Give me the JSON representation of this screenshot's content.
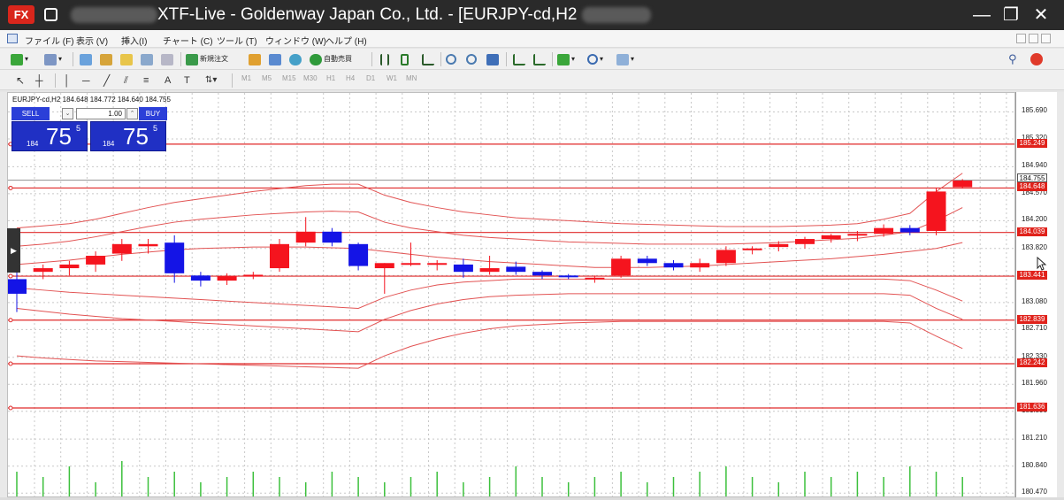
{
  "title_bar": {
    "title": "XTF-Live - Goldenway Japan Co., Ltd. - [EURJPY-cd,H2 ",
    "logo": "FX",
    "minimize_glyph": "—",
    "maximize_glyph": "❐",
    "close_glyph": "✕"
  },
  "menu": {
    "items": [
      "ファイル (F)",
      "表示 (V)",
      "挿入(I)",
      "チャート (C)",
      "ツール (T)",
      "ウィンドウ (W)",
      "ヘルプ (H)"
    ]
  },
  "toolbar": {
    "new_order_label": "新規注文",
    "auto_trading_label": "自動売買"
  },
  "timeframes": [
    "M1",
    "M5",
    "M15",
    "M30",
    "H1",
    "H4",
    "D1",
    "W1",
    "MN"
  ],
  "chart": {
    "symbol_label": "EURJPY-cd,H2  184.648 184.772 184.640 184.755",
    "price_ticks": [
      "185.690",
      "185.320",
      "184.940",
      "184.570",
      "184.200",
      "183.820",
      "183.450",
      "183.080",
      "182.710",
      "182.330",
      "181.960",
      "181.590",
      "181.210",
      "180.840",
      "180.470"
    ],
    "tags": {
      "bid": "184.755",
      "lines": [
        "185.249",
        "184.648",
        "184.039",
        "183.441",
        "182.839",
        "182.242",
        "181.636"
      ]
    },
    "colors": {
      "bull": "#f5141e",
      "bear": "#1414e6",
      "band": "#e25353",
      "level": "#e02a2a",
      "grid": "#c8c8c8"
    }
  },
  "trade_panel": {
    "sell_label": "SELL",
    "buy_label": "BUY",
    "lot": "1.00",
    "spin_down": "⌄",
    "spin_up": "⌃",
    "sell_quote": {
      "big": "184",
      "main": "75",
      "sup": "5"
    },
    "buy_quote": {
      "big": "184",
      "main": "75",
      "sup": "5"
    }
  },
  "chart_data": {
    "type": "candlestick",
    "symbol": "EURJPY-cd",
    "timeframe": "H2",
    "ylim": [
      180.4,
      185.95
    ],
    "candles": [
      {
        "o": 183.4,
        "h": 183.55,
        "l": 182.95,
        "c": 183.2
      },
      {
        "o": 183.5,
        "h": 183.6,
        "l": 183.4,
        "c": 183.55
      },
      {
        "o": 183.55,
        "h": 183.65,
        "l": 183.45,
        "c": 183.6
      },
      {
        "o": 183.6,
        "h": 183.78,
        "l": 183.5,
        "c": 183.72
      },
      {
        "o": 183.75,
        "h": 183.95,
        "l": 183.65,
        "c": 183.88
      },
      {
        "o": 183.85,
        "h": 183.95,
        "l": 183.75,
        "c": 183.88
      },
      {
        "o": 183.9,
        "h": 184.0,
        "l": 183.35,
        "c": 183.48
      },
      {
        "o": 183.45,
        "h": 183.5,
        "l": 183.3,
        "c": 183.38
      },
      {
        "o": 183.38,
        "h": 183.48,
        "l": 183.32,
        "c": 183.44
      },
      {
        "o": 183.44,
        "h": 183.5,
        "l": 183.4,
        "c": 183.46
      },
      {
        "o": 183.55,
        "h": 183.95,
        "l": 183.5,
        "c": 183.88
      },
      {
        "o": 183.9,
        "h": 184.25,
        "l": 183.85,
        "c": 184.05
      },
      {
        "o": 184.05,
        "h": 184.1,
        "l": 183.85,
        "c": 183.9
      },
      {
        "o": 183.88,
        "h": 183.9,
        "l": 183.52,
        "c": 183.58
      },
      {
        "o": 183.55,
        "h": 183.62,
        "l": 183.2,
        "c": 183.62
      },
      {
        "o": 183.62,
        "h": 183.9,
        "l": 183.58,
        "c": 183.62
      },
      {
        "o": 183.6,
        "h": 183.66,
        "l": 183.52,
        "c": 183.62
      },
      {
        "o": 183.6,
        "h": 183.68,
        "l": 183.42,
        "c": 183.5
      },
      {
        "o": 183.5,
        "h": 183.72,
        "l": 183.46,
        "c": 183.55
      },
      {
        "o": 183.57,
        "h": 183.64,
        "l": 183.46,
        "c": 183.5
      },
      {
        "o": 183.5,
        "h": 183.52,
        "l": 183.4,
        "c": 183.45
      },
      {
        "o": 183.45,
        "h": 183.47,
        "l": 183.4,
        "c": 183.44
      },
      {
        "o": 183.4,
        "h": 183.45,
        "l": 183.35,
        "c": 183.42
      },
      {
        "o": 183.45,
        "h": 183.72,
        "l": 183.42,
        "c": 183.68
      },
      {
        "o": 183.68,
        "h": 183.72,
        "l": 183.58,
        "c": 183.62
      },
      {
        "o": 183.62,
        "h": 183.66,
        "l": 183.52,
        "c": 183.56
      },
      {
        "o": 183.56,
        "h": 183.68,
        "l": 183.5,
        "c": 183.62
      },
      {
        "o": 183.62,
        "h": 183.85,
        "l": 183.58,
        "c": 183.8
      },
      {
        "o": 183.8,
        "h": 183.85,
        "l": 183.74,
        "c": 183.82
      },
      {
        "o": 183.84,
        "h": 183.92,
        "l": 183.78,
        "c": 183.88
      },
      {
        "o": 183.88,
        "h": 183.98,
        "l": 183.82,
        "c": 183.95
      },
      {
        "o": 183.95,
        "h": 184.02,
        "l": 183.9,
        "c": 184.0
      },
      {
        "o": 184.0,
        "h": 184.06,
        "l": 183.92,
        "c": 184.02
      },
      {
        "o": 184.02,
        "h": 184.15,
        "l": 183.98,
        "c": 184.1
      },
      {
        "o": 184.1,
        "h": 184.14,
        "l": 184.0,
        "c": 184.04
      },
      {
        "o": 184.06,
        "h": 184.65,
        "l": 184.0,
        "c": 184.6
      },
      {
        "o": 184.66,
        "h": 184.77,
        "l": 184.64,
        "c": 184.75
      }
    ],
    "bands": [
      {
        "name": "upper-outer",
        "values": [
          184.1,
          184.13,
          184.16,
          184.22,
          184.3,
          184.38,
          184.45,
          184.5,
          184.55,
          184.6,
          184.64,
          184.68,
          184.7,
          184.7,
          184.55,
          184.45,
          184.38,
          184.32,
          184.28,
          184.24,
          184.22,
          184.2,
          184.18,
          184.16,
          184.15,
          184.14,
          184.13,
          184.12,
          184.12,
          184.12,
          184.13,
          184.14,
          184.16,
          184.22,
          184.3,
          184.6,
          184.85
        ]
      },
      {
        "name": "upper-inner",
        "values": [
          183.85,
          183.88,
          183.92,
          183.98,
          184.05,
          184.12,
          184.18,
          184.22,
          184.25,
          184.28,
          184.3,
          184.32,
          184.33,
          184.32,
          184.18,
          184.1,
          184.05,
          184.0,
          183.97,
          183.95,
          183.93,
          183.91,
          183.9,
          183.89,
          183.88,
          183.88,
          183.88,
          183.88,
          183.89,
          183.9,
          183.92,
          183.94,
          183.96,
          184.0,
          184.05,
          184.2,
          184.38
        ]
      },
      {
        "name": "middle",
        "values": [
          183.6,
          183.63,
          183.66,
          183.7,
          183.74,
          183.77,
          183.8,
          183.82,
          183.83,
          183.84,
          183.84,
          183.84,
          183.83,
          183.82,
          183.78,
          183.74,
          183.7,
          183.67,
          183.64,
          183.62,
          183.6,
          183.58,
          183.56,
          183.56,
          183.56,
          183.57,
          183.58,
          183.6,
          183.62,
          183.64,
          183.66,
          183.68,
          183.71,
          183.74,
          183.78,
          183.82,
          183.9
        ]
      },
      {
        "name": "lower-inner",
        "values": [
          183.28,
          183.25,
          183.22,
          183.2,
          183.18,
          183.16,
          183.14,
          183.12,
          183.1,
          183.08,
          183.06,
          183.04,
          183.02,
          183.0,
          183.15,
          183.25,
          183.32,
          183.36,
          183.38,
          183.4,
          183.4,
          183.4,
          183.4,
          183.4,
          183.4,
          183.4,
          183.4,
          183.4,
          183.4,
          183.4,
          183.4,
          183.4,
          183.4,
          183.4,
          183.38,
          183.25,
          183.1
        ]
      },
      {
        "name": "lower-outer",
        "values": [
          183.0,
          182.96,
          182.92,
          182.89,
          182.86,
          182.84,
          182.82,
          182.8,
          182.78,
          182.76,
          182.74,
          182.72,
          182.7,
          182.68,
          182.85,
          182.97,
          183.06,
          183.12,
          183.16,
          183.18,
          183.19,
          183.2,
          183.2,
          183.2,
          183.2,
          183.2,
          183.2,
          183.2,
          183.2,
          183.2,
          183.2,
          183.2,
          183.2,
          183.2,
          183.18,
          183.0,
          182.85
        ]
      },
      {
        "name": "lower-far",
        "values": [
          182.35,
          182.32,
          182.3,
          182.28,
          182.27,
          182.26,
          182.25,
          182.24,
          182.23,
          182.22,
          182.21,
          182.2,
          182.19,
          182.18,
          182.35,
          182.48,
          182.58,
          182.66,
          182.72,
          182.76,
          182.78,
          182.8,
          182.81,
          182.82,
          182.82,
          182.82,
          182.82,
          182.82,
          182.82,
          182.82,
          182.82,
          182.82,
          182.82,
          182.82,
          182.8,
          182.62,
          182.45
        ]
      }
    ],
    "levels": [
      185.249,
      184.648,
      184.039,
      183.441,
      182.839,
      182.242,
      181.636
    ],
    "volume": [
      0.5,
      0.4,
      0.6,
      0.3,
      0.7,
      0.4,
      0.5,
      0.3,
      0.4,
      0.5,
      0.4,
      0.3,
      0.5,
      0.4,
      0.3,
      0.4,
      0.5,
      0.3,
      0.4,
      0.6,
      0.4,
      0.3,
      0.4,
      0.5,
      0.3,
      0.4,
      0.5,
      0.6,
      0.4,
      0.3,
      0.5,
      0.4,
      0.5,
      0.4,
      0.6,
      0.5,
      0.4
    ]
  }
}
